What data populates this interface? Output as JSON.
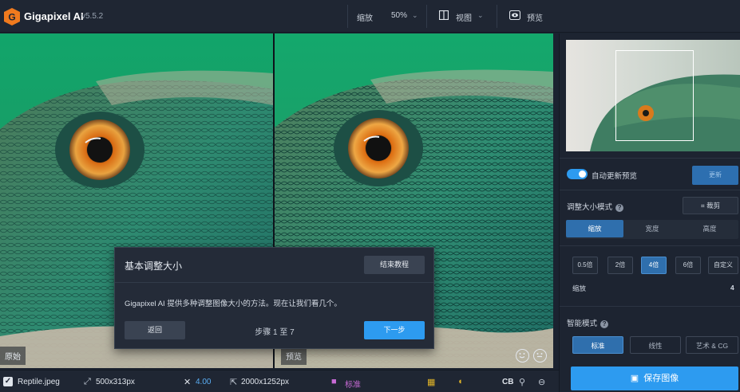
{
  "app": {
    "name": "Gigapixel AI",
    "version": "v5.5.2"
  },
  "toolbar": {
    "zoom_label": "缩放",
    "zoom_value": "50%",
    "view_label": "视图",
    "preview_label": "预览"
  },
  "panes": {
    "left_label": "原始",
    "right_label": "预览"
  },
  "dialog": {
    "title": "基本调整大小",
    "end_button": "结束教程",
    "body": "Gigapixel AI 提供多种调整图像大小的方法。现在让我们看几个。",
    "back_button": "返回",
    "step_text": "步骤 1 至 7",
    "next_button": "下一步"
  },
  "status": {
    "filename": "Reptile.jpeg",
    "source_size": "500x313px",
    "scale": "4.00",
    "output_size": "2000x1252px",
    "model": "标准",
    "format": "CB"
  },
  "right_panel": {
    "auto_update_label": "自动更新预览",
    "update_button": "更新",
    "resize_mode_label": "调整大小模式",
    "crop_button": "裁剪",
    "resize_tabs": [
      "缩放",
      "宽度",
      "高度"
    ],
    "resize_tab_active": 0,
    "scale_options": [
      "0.5倍",
      "2倍",
      "4倍",
      "6倍",
      "自定义"
    ],
    "scale_active": 2,
    "scale_label": "缩放",
    "scale_value": "4",
    "ai_model_label": "智能模式",
    "model_tabs": [
      "标准",
      "线性",
      "艺术 & CG"
    ],
    "model_active": 0,
    "save_button": "保存图像"
  },
  "colors": {
    "accent": "#2d9bf0",
    "active_tab": "#2f6fad",
    "background": "#1b2230"
  },
  "icons": [
    "gigapixel-logo-icon",
    "view-icon",
    "eye-icon",
    "checkbox-icon",
    "resize-icon",
    "scale-icon",
    "output-icon",
    "model-icon",
    "face-icon",
    "crop-icon",
    "help-icon",
    "save-icon"
  ]
}
